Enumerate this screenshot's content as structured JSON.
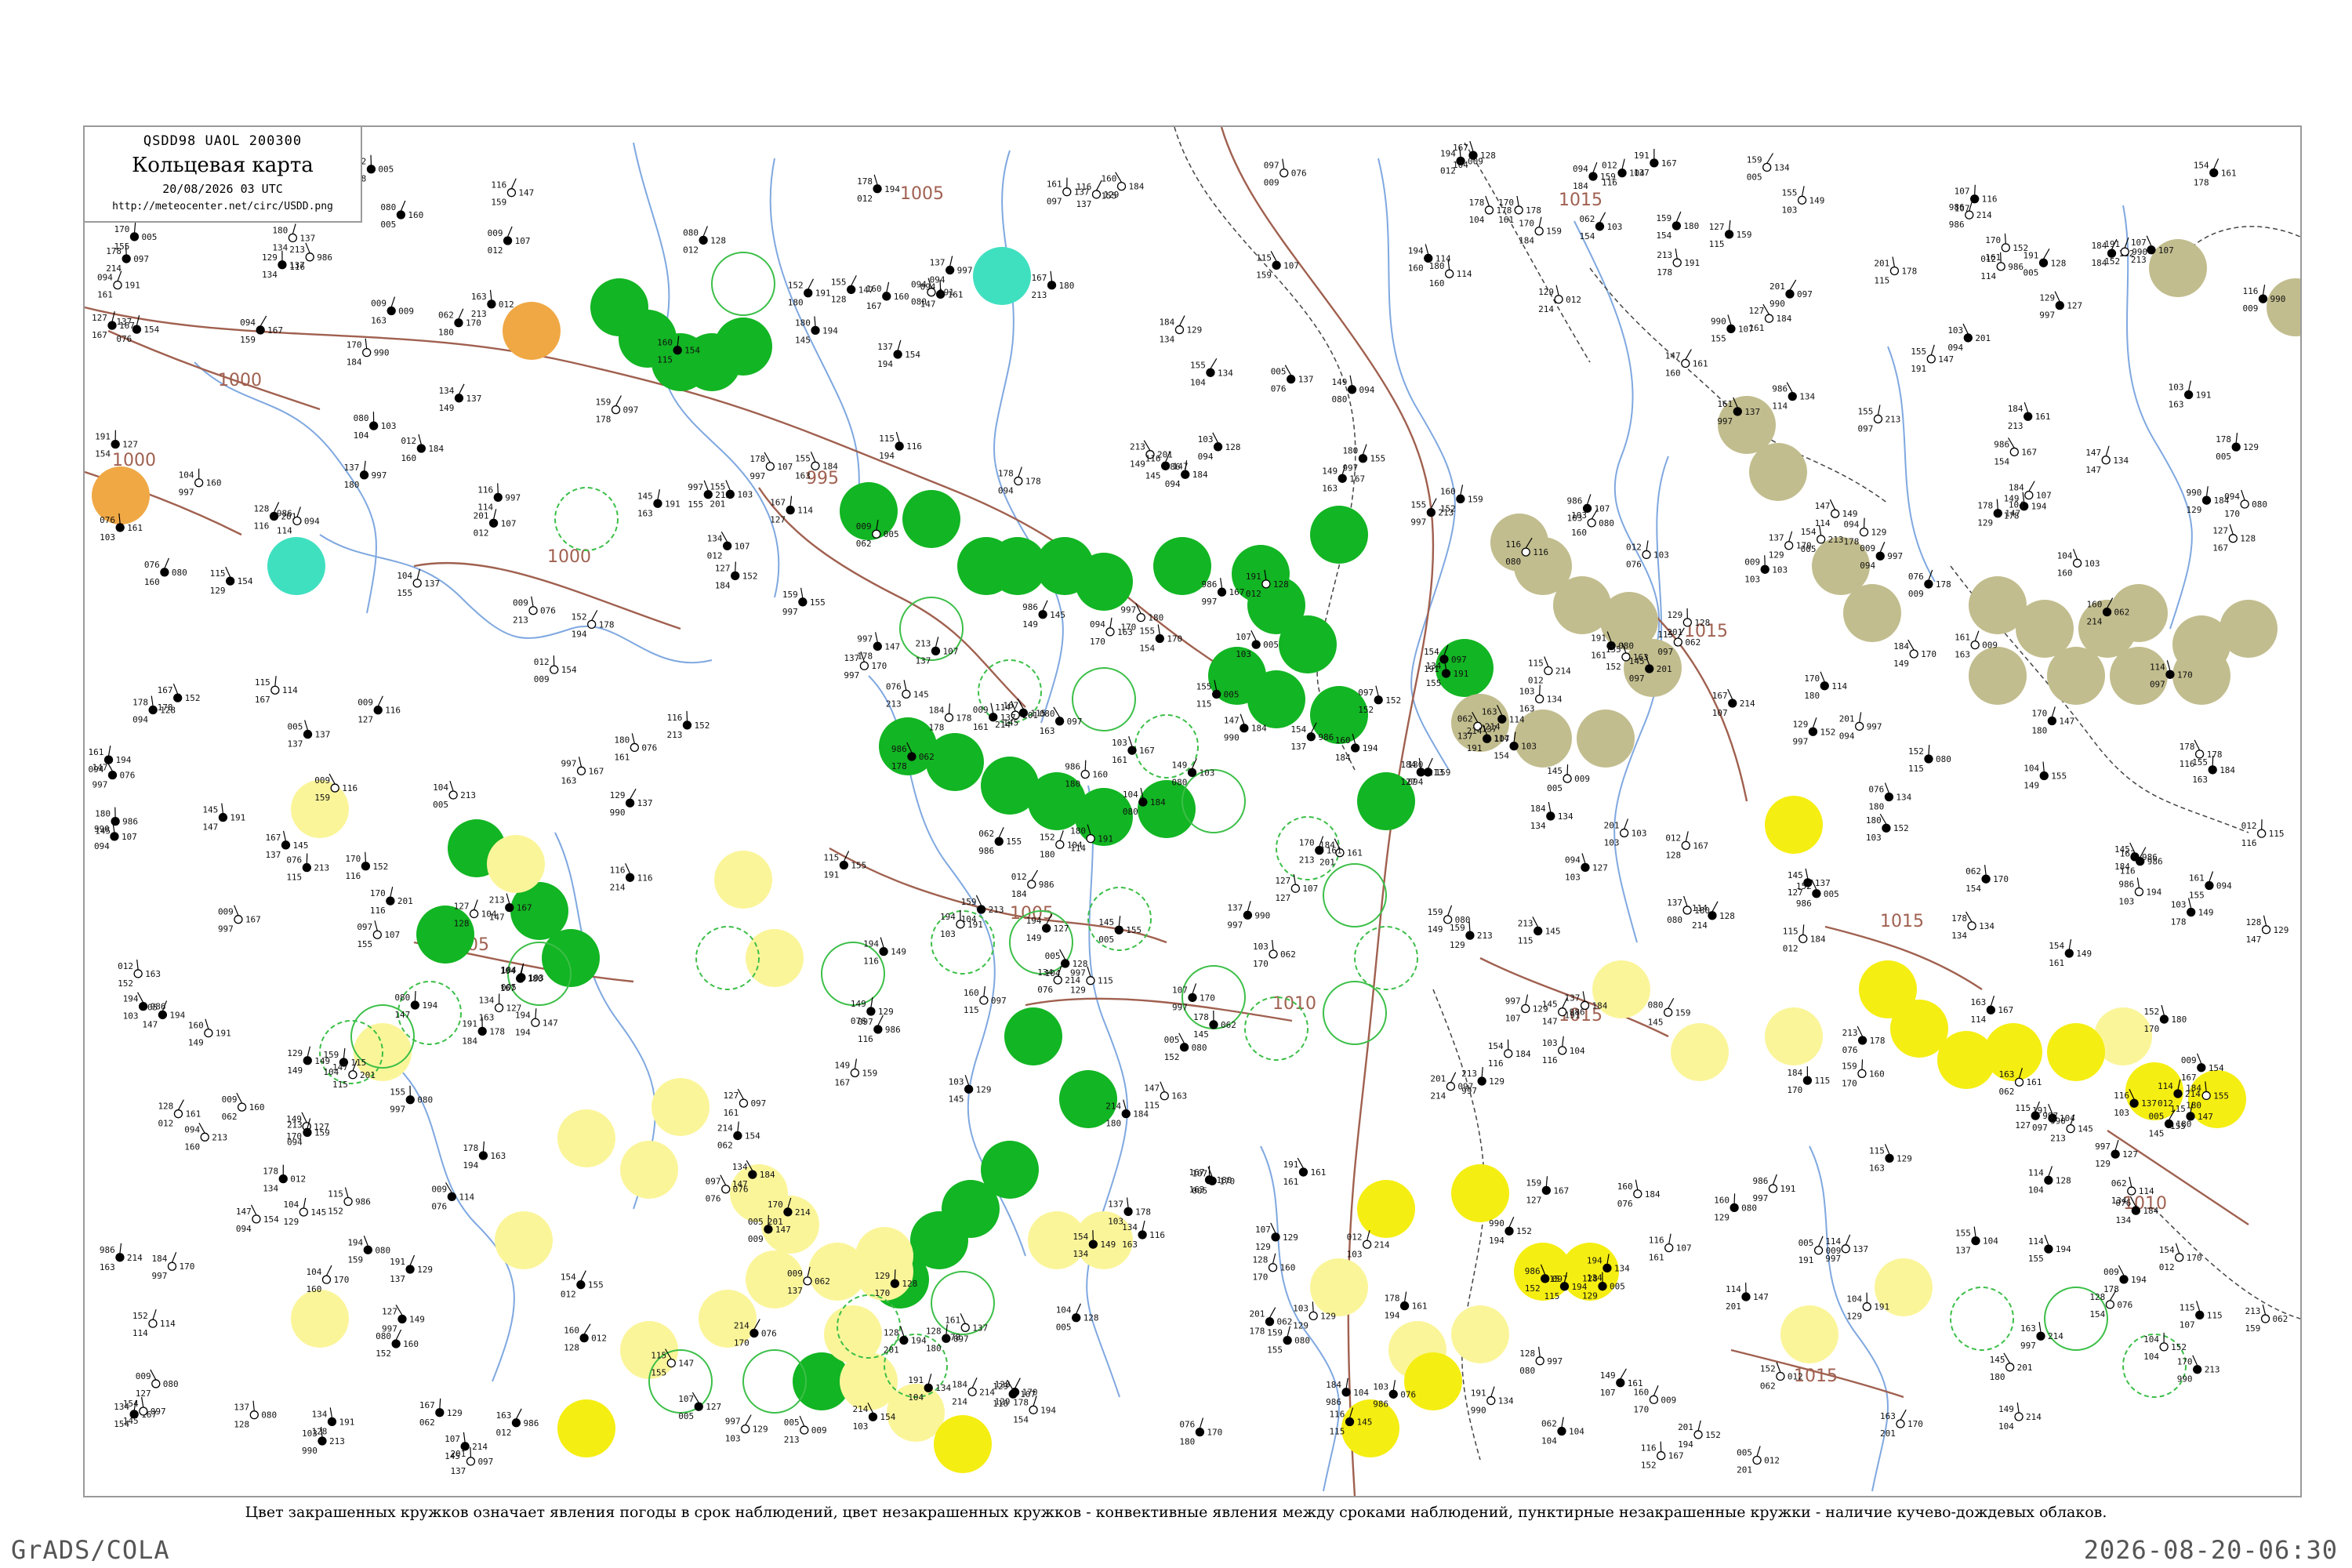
{
  "title_box": {
    "code_line": "QSDD98  UAOL  200300",
    "name": "Кольцевая карта",
    "date": "20/08/2026 03 UTC",
    "url": "http://meteocenter.net/circ/USDD.png"
  },
  "caption": "Цвет закрашенных кружков означает явления погоды в срок наблюдений, цвет незакрашенных кружков - конвективные явления между сроками наблюдений, пунктирные незакрашенные кружки - наличие кучево-дождевых облаков.",
  "footer": {
    "left": "GrADS/COLA",
    "right": "2026-08-20-06:30"
  },
  "colors": {
    "frame": "#9a9a9a",
    "isobar": "#a0604f",
    "rivers": "#7fa8e0",
    "borders": "#444444",
    "rain_green": "#12b523",
    "light_yellow": "#fbf59a",
    "yellow": "#f5ee12",
    "olive": "#c2bd8e",
    "orange": "#f0a845",
    "cyan": "#3fe0c0",
    "dashed_green": "#3cbf48"
  },
  "isobars": [
    {
      "label": "1005"
    },
    {
      "label": "1015"
    },
    {
      "label": "1000"
    },
    {
      "label": "1000"
    },
    {
      "label": "1000"
    },
    {
      "label": "995"
    },
    {
      "label": "1005"
    },
    {
      "label": "1005"
    },
    {
      "label": "1010"
    },
    {
      "label": "1015"
    },
    {
      "label": "1015"
    },
    {
      "label": "1015"
    },
    {
      "label": "1010"
    },
    {
      "label": "1015"
    }
  ],
  "station_markers": {
    "filled_green": 38,
    "light_yellow": 32,
    "yellow": 16,
    "olive": 24,
    "orange": 2,
    "cyan": 2,
    "dashed_green_outline": 30
  },
  "sample_values": [
    "128",
    "986",
    "990",
    "115",
    "997",
    "107",
    "114",
    "080",
    "062",
    "076",
    "129",
    "213",
    "152",
    "201",
    "163",
    "214",
    "149",
    "159",
    "170",
    "097",
    "103",
    "145",
    "147",
    "160",
    "094",
    "127",
    "104",
    "154",
    "116",
    "009",
    "005",
    "012",
    "134",
    "161",
    "137",
    "155",
    "180",
    "167",
    "184",
    "194",
    "178",
    "191"
  ]
}
